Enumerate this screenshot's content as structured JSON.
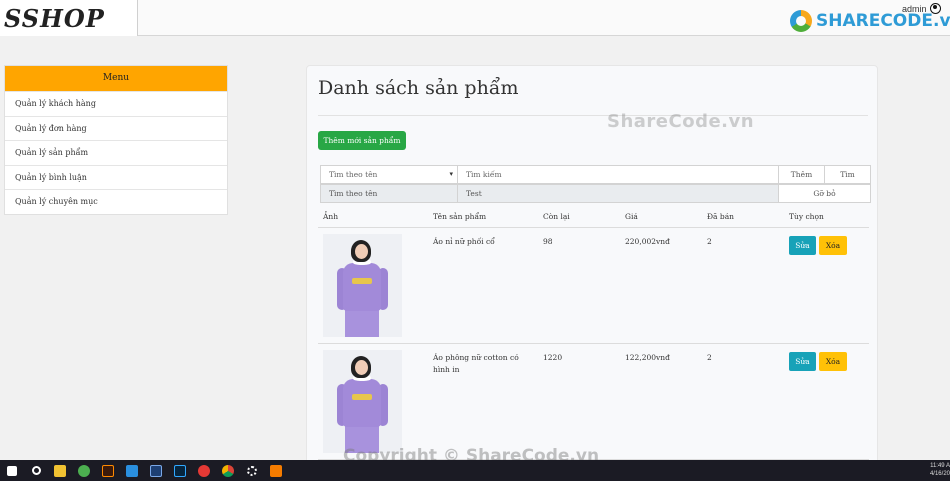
{
  "header": {
    "logo": "SSHOP",
    "user": "admin",
    "watermark_logo": "SHARECODE.vn"
  },
  "sidebar": {
    "title": "Menu",
    "items": [
      {
        "label": "Quản lý khách hàng"
      },
      {
        "label": "Quản lý đơn hàng"
      },
      {
        "label": "Quản lý sản phẩm"
      },
      {
        "label": "Quản lý bình luận"
      },
      {
        "label": "Quản lý chuyên mục"
      }
    ]
  },
  "main": {
    "title": "Danh sách sản phẩm",
    "add_button": "Thêm mới sản phẩm",
    "filter": {
      "select_value": "Tìm theo tên",
      "search_placeholder": "Tìm kiếm",
      "add_label": "Thêm",
      "search_label": "Tìm",
      "active_filter_field": "Tìm theo tên",
      "active_filter_value": "Test",
      "clear_label": "Gỡ bỏ"
    },
    "table": {
      "headers": [
        "Ảnh",
        "Tên sản phẩm",
        "Còn lại",
        "Giá",
        "Đã bán",
        "Tùy chọn"
      ],
      "rows": [
        {
          "name": "Áo nỉ nữ phối cổ",
          "stock": "98",
          "price": "220,002vnđ",
          "sold": "2",
          "edit": "Sửa",
          "delete": "Xóa"
        },
        {
          "name": "Áo phông nữ cotton có hình in",
          "stock": "1220",
          "price": "122,200vnđ",
          "sold": "2",
          "edit": "Sửa",
          "delete": "Xóa"
        }
      ]
    }
  },
  "watermarks": {
    "center": "ShareCode.vn",
    "bottom": "Copyright © ShareCode.vn"
  },
  "taskbar": {
    "time": "11:49 A",
    "date": "4/16/20"
  },
  "colors": {
    "menu_header": "#ffa500",
    "add_button": "#28a745",
    "edit_button": "#17a2b8",
    "delete_button": "#ffc107"
  }
}
